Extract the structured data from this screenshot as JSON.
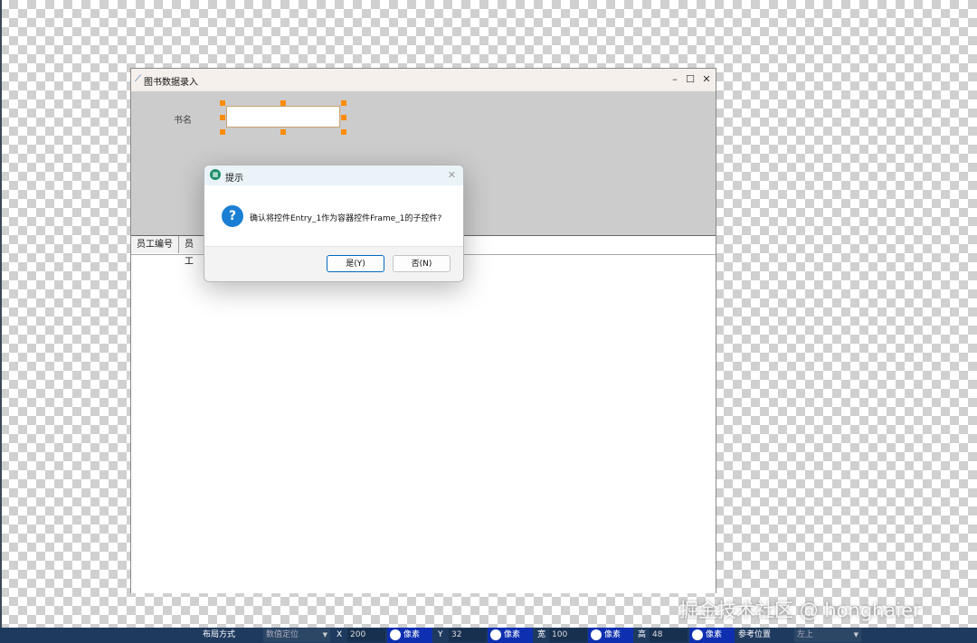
{
  "design_window": {
    "title": "图书数据录入",
    "minimize": "–",
    "maximize": "☐",
    "close": "✕",
    "field_label": "书名",
    "entry_value": "",
    "columns": [
      "员工编号",
      "员工"
    ]
  },
  "dialog": {
    "title": "提示",
    "message": "确认将控件Entry_1作为容器控件Frame_1的子控件?",
    "yes_label": "是(Y)",
    "no_label": "否(N)",
    "close": "✕"
  },
  "watermark": "掘金技术社区 @ honghaier",
  "toolbar": {
    "layout_label": "布局方式",
    "layout_value": "数值定位",
    "x_label": "X",
    "x_value": "200",
    "x_unit": "像素",
    "y_label": "Y",
    "y_value": "32",
    "y_unit": "像素",
    "w_label": "宽",
    "w_value": "100",
    "w_unit": "像素",
    "h_label": "高",
    "h_value": "48",
    "h_unit": "像素",
    "ref_label": "参考位置",
    "ref_value": "左上"
  },
  "colors": {
    "accent": "#1a7fd4",
    "handle": "#ff8c00",
    "toolbar": "#1f3a5f",
    "radio": "#0d2fb0"
  }
}
